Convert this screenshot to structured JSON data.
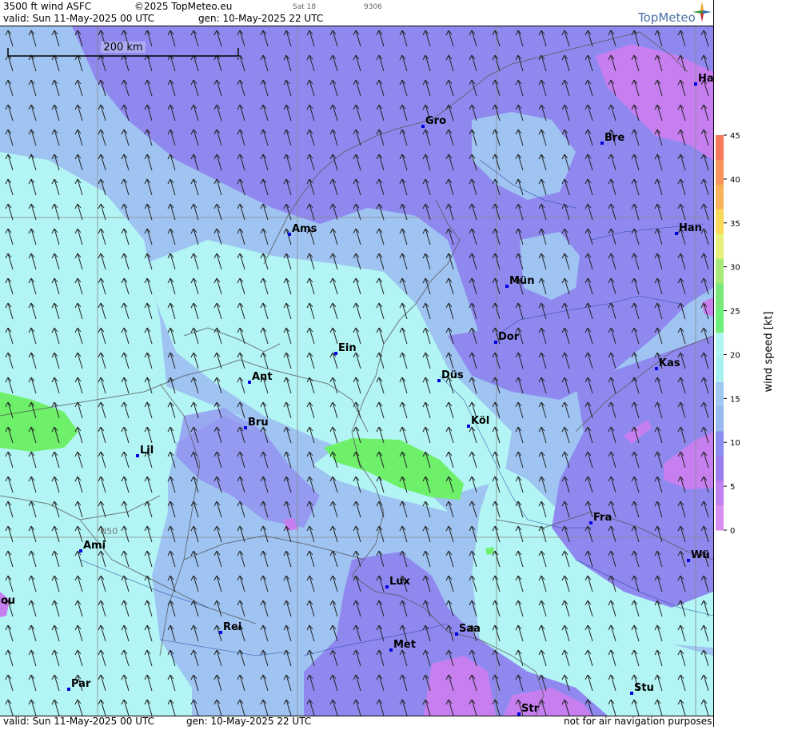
{
  "header": {
    "product": "3500 ft wind ASFC",
    "copyright": "©2025 TopMeteo.eu",
    "satellite": "Sat 18",
    "code": "9306",
    "valid": "valid:  Sun  11-May-2025  00 UTC",
    "generated": "gen: 10-May-2025 22 UTC",
    "logo": "TopMeteo"
  },
  "footer": {
    "valid": "valid:  Sun  11-May-2025  00 UTC",
    "generated": "gen: 10-May-2025 22 UTC",
    "disclaimer": "not for air navigation purposes"
  },
  "scale_bar": {
    "label": "200 km"
  },
  "latitude_label": "N50",
  "cities": [
    {
      "name": "Gro"
    },
    {
      "name": "Bre"
    },
    {
      "name": "Ha"
    },
    {
      "name": "Ams"
    },
    {
      "name": "Han"
    },
    {
      "name": "Mün"
    },
    {
      "name": "Dor"
    },
    {
      "name": "Ein"
    },
    {
      "name": "Ant"
    },
    {
      "name": "Düs"
    },
    {
      "name": "Kas"
    },
    {
      "name": "Bru"
    },
    {
      "name": "Köl"
    },
    {
      "name": "Lil"
    },
    {
      "name": "Fra"
    },
    {
      "name": "Ami"
    },
    {
      "name": "Wü"
    },
    {
      "name": "Lux"
    },
    {
      "name": "ou"
    },
    {
      "name": "Rei"
    },
    {
      "name": "Saa"
    },
    {
      "name": "Met"
    },
    {
      "name": "Stu"
    },
    {
      "name": "Par"
    },
    {
      "name": "Str"
    }
  ],
  "legend": {
    "title": "wind  speed  [kt]",
    "ticks": [
      "45",
      "40",
      "35",
      "30",
      "25",
      "20",
      "15",
      "10",
      "5",
      "0"
    ],
    "colors": [
      "#f47a5a",
      "#f5935a",
      "#f8b25a",
      "#fbd95a",
      "#e8f07a",
      "#a8ea7a",
      "#7ae87a",
      "#6ef07a",
      "#b0f5f0",
      "#a8f0f0",
      "#9ec8f0",
      "#98b8f0",
      "#8a8cf0",
      "#9a7cf0",
      "#c080f0",
      "#d890f0"
    ],
    "colorsMeaning": "from 45 kt (top) to 0 kt (bottom)"
  },
  "map_colors": {
    "calm": "#c77ff0",
    "light": "#8f89ef",
    "moderate": "#9fc4f2",
    "fresh": "#b0f5f5",
    "strong": "#6ef06a"
  }
}
